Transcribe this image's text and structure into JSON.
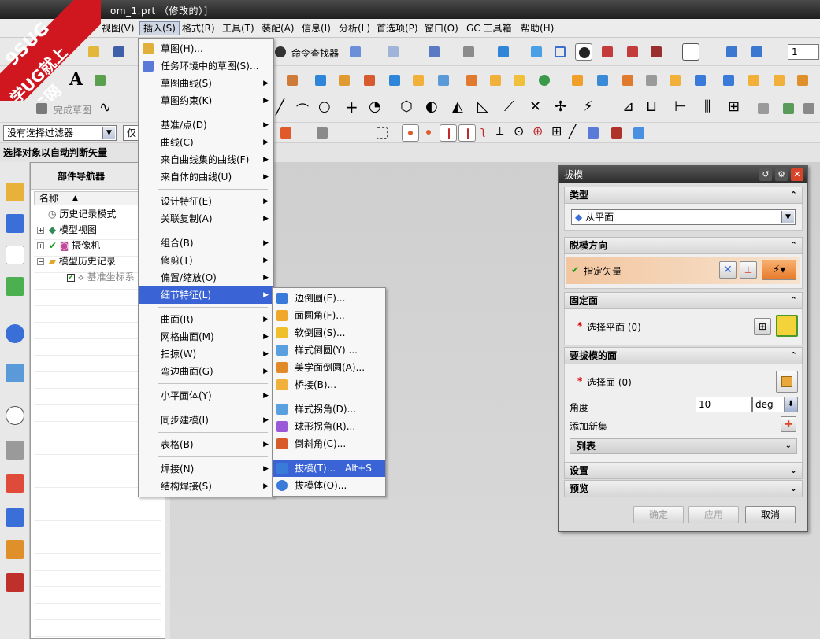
{
  "window": {
    "title_fragment": "om_1.prt （修改的）]"
  },
  "watermark": {
    "line1": "9SUG",
    "line2": "学UG就上UG网"
  },
  "menubar": {
    "items": [
      "视图(V)",
      "插入(S)",
      "格式(R)",
      "工具(T)",
      "装配(A)",
      "信息(I)",
      "分析(L)",
      "首选项(P)",
      "窗口(O)",
      "GC 工具箱",
      "帮助(H)"
    ]
  },
  "toolbar": {
    "command_finder": "命令查找器",
    "finish_sketch": "完成草图",
    "layer_value": "1"
  },
  "filter": {
    "selection_filter": "没有选择过滤器",
    "scope": "仅在"
  },
  "status": {
    "prompt": "选择对象以自动判断矢量"
  },
  "navigator": {
    "title": "部件导航器",
    "column": "名称",
    "rows": [
      "历史记录模式",
      "模型视图",
      "摄像机",
      "模型历史记录",
      "基准坐标系"
    ]
  },
  "insert_menu": {
    "items": [
      "草图(H)...",
      "任务环境中的草图(S)...",
      "草图曲线(S)",
      "草图约束(K)",
      "基准/点(D)",
      "曲线(C)",
      "来自曲线集的曲线(F)",
      "来自体的曲线(U)",
      "设计特征(E)",
      "关联复制(A)",
      "组合(B)",
      "修剪(T)",
      "偏置/缩放(O)",
      "细节特征(L)",
      "曲面(R)",
      "网格曲面(M)",
      "扫掠(W)",
      "弯边曲面(G)",
      "小平面体(Y)",
      "同步建模(I)",
      "表格(B)",
      "焊接(N)",
      "结构焊接(S)"
    ]
  },
  "detail_menu": {
    "items": [
      "边倒圆(E)...",
      "面圆角(F)...",
      "软倒圆(S)...",
      "样式倒圆(Y) ...",
      "美学面倒圆(A)...",
      "桥接(B)...",
      "样式拐角(D)...",
      "球形拐角(R)...",
      "倒斜角(C)...",
      "拔模(T)...",
      "拔模体(O)..."
    ],
    "shortcut": "Alt+S"
  },
  "dialog": {
    "title": "拔模",
    "type_section": "类型",
    "type_value": "从平面",
    "direction_section": "脱模方向",
    "specify_vector": "指定矢量",
    "fixed_section": "固定面",
    "select_plane": "选择平面 (0)",
    "draft_faces_section": "要拔模的面",
    "select_face": "选择面 (0)",
    "angle_label": "角度",
    "angle_value": "10",
    "angle_unit": "deg",
    "add_new_set": "添加新集",
    "list_label": "列表",
    "settings_section": "设置",
    "preview_section": "预览",
    "ok": "确定",
    "apply": "应用",
    "cancel": "取消",
    "required_mark": "*"
  }
}
